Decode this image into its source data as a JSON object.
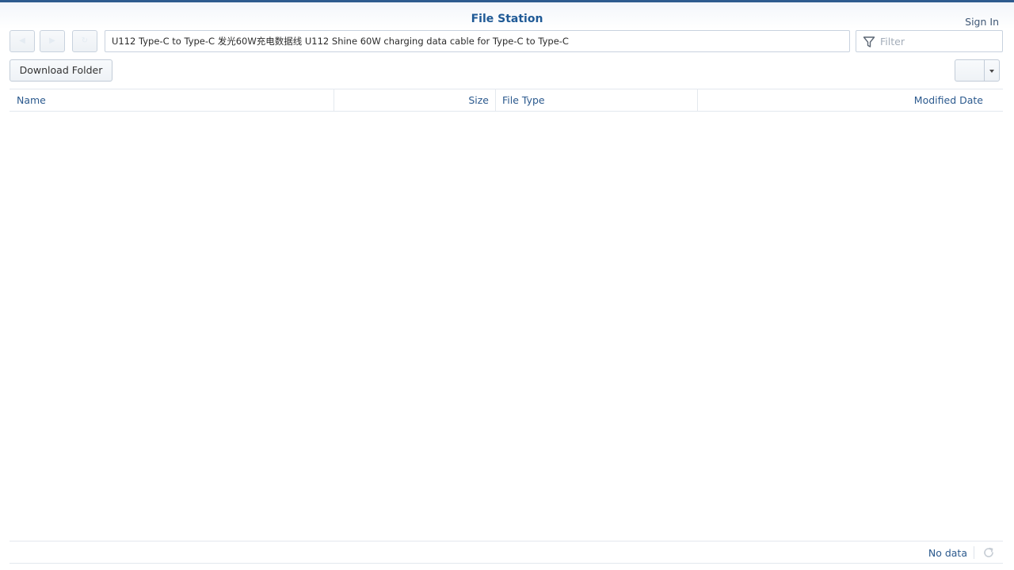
{
  "app": {
    "title": "File Station",
    "sign_in_label": "Sign In"
  },
  "toolbar": {
    "back_icon": "back-arrow-icon",
    "forward_icon": "forward-arrow-icon",
    "refresh_icon": "refresh-icon",
    "path_value": "U112 Type-C to Type-C 发光60W充电数据线 U112 Shine 60W charging data cable for Type-C to Type-C",
    "filter_placeholder": "Filter",
    "filter_icon": "filter-funnel-icon",
    "download_folder_label": "Download Folder",
    "view_icon": "view-mode-icon",
    "view_dropdown_icon": "caret-down-icon"
  },
  "grid": {
    "columns": [
      "Name",
      "Size",
      "File Type",
      "Modified Date"
    ],
    "rows": []
  },
  "status": {
    "text": "No data",
    "reload_icon": "reload-icon"
  },
  "colors": {
    "accent": "#1f5a96",
    "header_text": "#2c5a8e",
    "border": "#c8d2de",
    "top_bar": "#2d5b8e"
  }
}
